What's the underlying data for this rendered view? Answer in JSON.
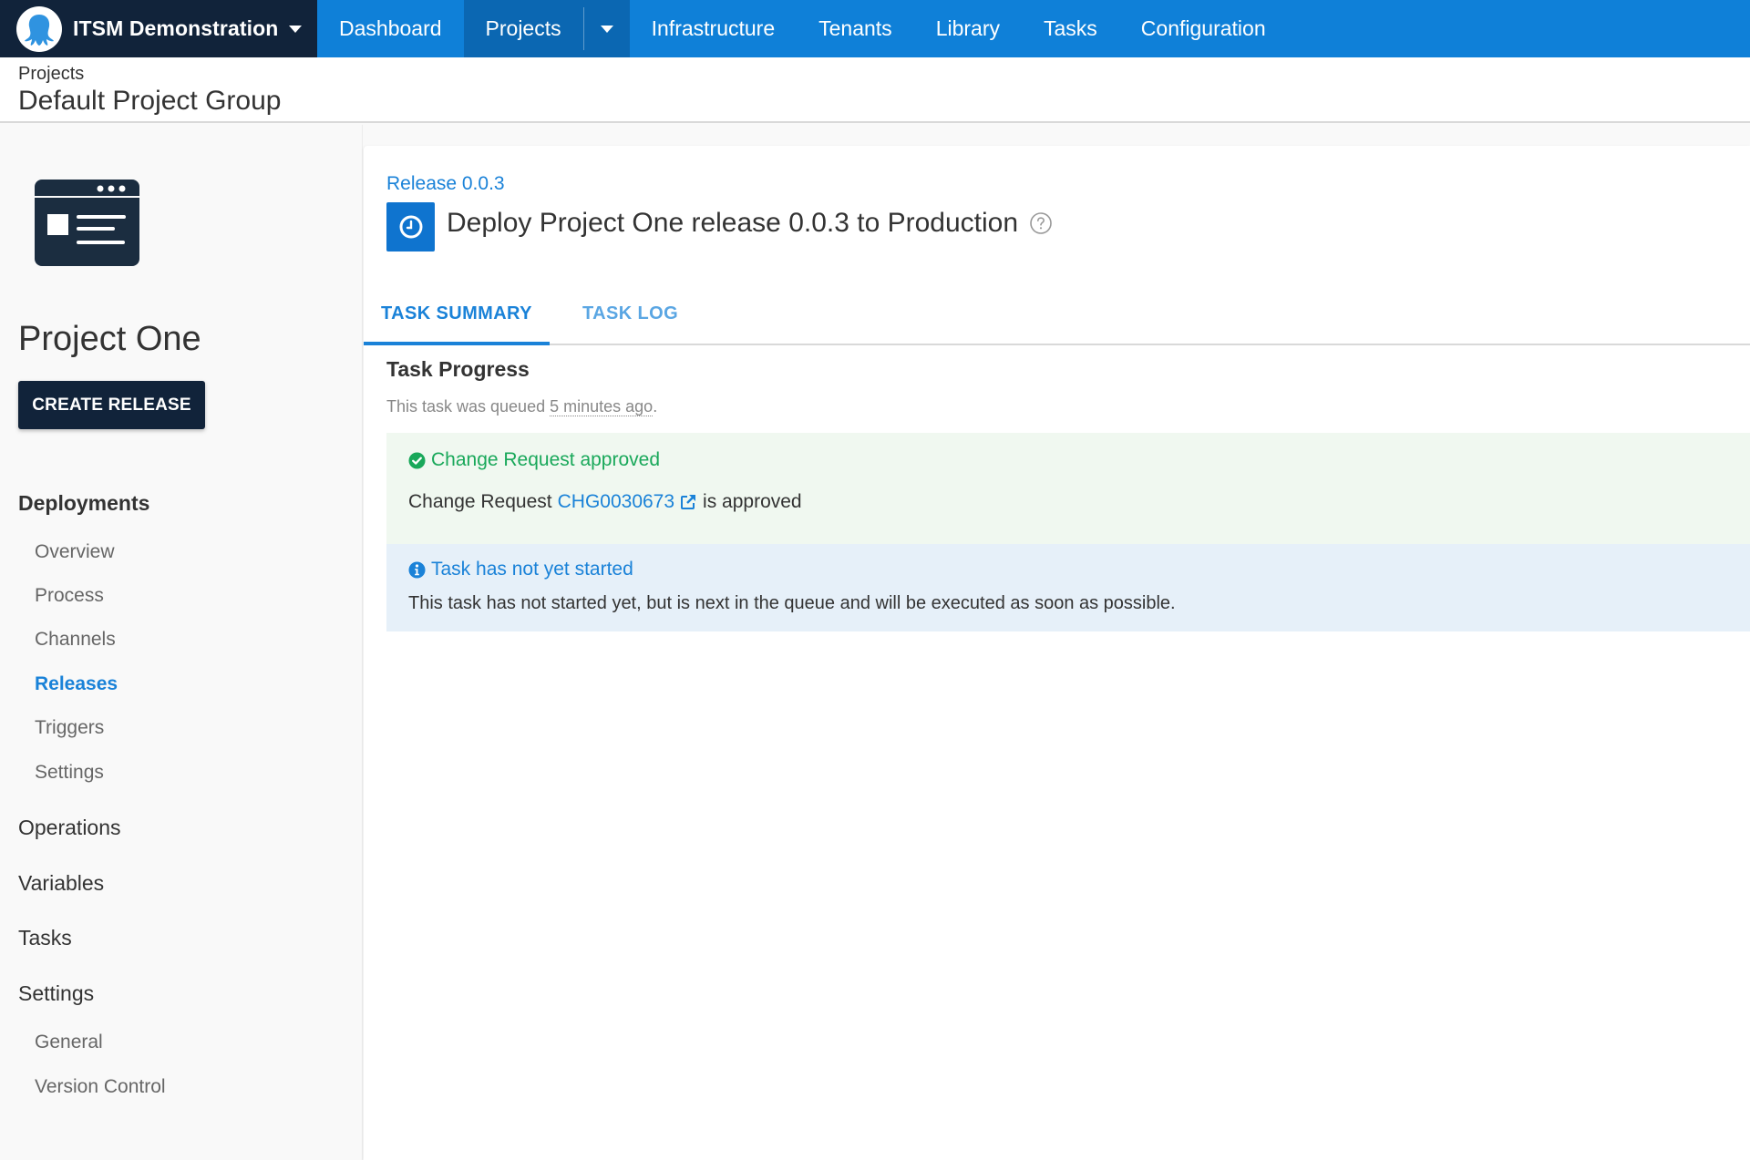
{
  "topnav": {
    "brand": "ITSM Demonstration",
    "items": [
      {
        "label": "Dashboard"
      },
      {
        "label": "Projects",
        "active": true
      },
      {
        "label": "Infrastructure"
      },
      {
        "label": "Tenants"
      },
      {
        "label": "Library"
      },
      {
        "label": "Tasks"
      },
      {
        "label": "Configuration"
      }
    ]
  },
  "header": {
    "breadcrumb": "Projects",
    "title": "Default Project Group"
  },
  "sidebar": {
    "project_name": "Project One",
    "create_release": "CREATE RELEASE",
    "sections": {
      "deployments": {
        "label": "Deployments",
        "items": [
          "Overview",
          "Process",
          "Channels",
          "Releases",
          "Triggers",
          "Settings"
        ],
        "active": "Releases"
      },
      "operations": "Operations",
      "variables": "Variables",
      "tasks": "Tasks",
      "settings": {
        "label": "Settings",
        "items": [
          "General",
          "Version Control"
        ]
      }
    }
  },
  "main": {
    "release_link": "Release 0.0.3",
    "title": "Deploy Project One release 0.0.3 to Production",
    "status_icon": "clock-icon",
    "tabs": [
      {
        "label": "TASK SUMMARY",
        "active": true
      },
      {
        "label": "TASK LOG",
        "active": false
      }
    ],
    "progress": {
      "heading": "Task Progress",
      "queued_prefix": "This task was queued ",
      "queued_when": "5 minutes ago",
      "queued_suffix": "."
    },
    "success": {
      "heading": "Change Request approved",
      "body_prefix": "Change Request",
      "change_id": "CHG0030673",
      "body_suffix": "is approved"
    },
    "info": {
      "heading": "Task has not yet started",
      "body": "This task has not started yet, but is next in the queue and will be executed as soon as possible."
    }
  },
  "colors": {
    "nav_blue": "#0f80d8",
    "nav_dark": "#11233a",
    "accent": "#1a82d8",
    "success": "#19a85a",
    "success_bg": "#f0f8f0",
    "info_bg": "#e6f0f9"
  }
}
